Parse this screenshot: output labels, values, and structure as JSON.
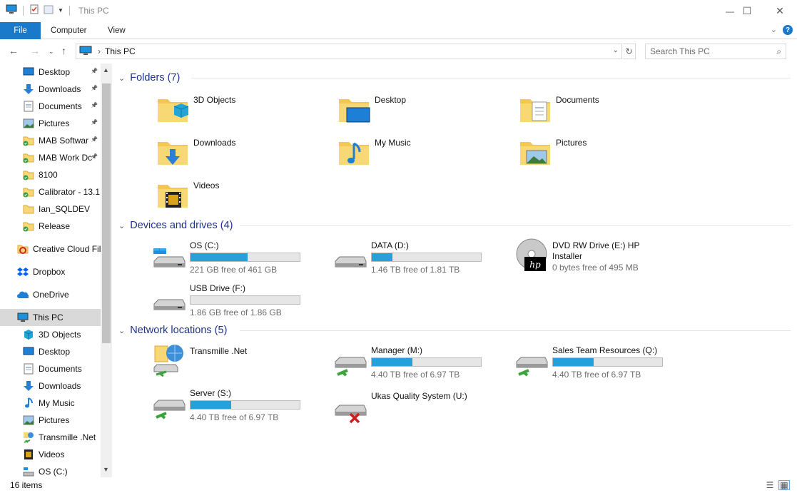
{
  "window": {
    "title": "This PC",
    "controls": {
      "minimize": "—",
      "maximize": "☐",
      "close": "✕"
    }
  },
  "ribbon": {
    "tabs": [
      "File",
      "Computer",
      "View"
    ],
    "help": "?"
  },
  "address": {
    "path": "This PC",
    "search_placeholder": "Search This PC"
  },
  "navpane": {
    "items": [
      {
        "label": "Desktop",
        "icon": "desktop-icon",
        "pinned": true
      },
      {
        "label": "Downloads",
        "icon": "downloads-icon",
        "pinned": true
      },
      {
        "label": "Documents",
        "icon": "documents-icon",
        "pinned": true
      },
      {
        "label": "Pictures",
        "icon": "pictures-icon",
        "pinned": true
      },
      {
        "label": "MAB Softwar",
        "icon": "folder-synced-icon",
        "pinned": true
      },
      {
        "label": "MAB Work Dc",
        "icon": "folder-synced-icon",
        "pinned": true
      },
      {
        "label": "8100",
        "icon": "folder-synced-icon",
        "pinned": false
      },
      {
        "label": "Calibrator - 13.1.",
        "icon": "folder-synced-icon",
        "pinned": false
      },
      {
        "label": "Ian_SQLDEV",
        "icon": "folder-icon",
        "pinned": false
      },
      {
        "label": "Release",
        "icon": "folder-synced-icon",
        "pinned": false
      },
      {
        "label": "Creative Cloud Fil",
        "icon": "creative-cloud-icon",
        "pinned": false
      },
      {
        "label": "Dropbox",
        "icon": "dropbox-icon",
        "pinned": false
      },
      {
        "label": "OneDrive",
        "icon": "onedrive-icon",
        "pinned": false
      },
      {
        "label": "This PC",
        "icon": "computer-icon",
        "pinned": false,
        "selected": true
      },
      {
        "label": "3D Objects",
        "icon": "3d-objects-icon",
        "pinned": false
      },
      {
        "label": "Desktop",
        "icon": "desktop-icon",
        "pinned": false
      },
      {
        "label": "Documents",
        "icon": "documents-icon",
        "pinned": false
      },
      {
        "label": "Downloads",
        "icon": "downloads-icon",
        "pinned": false
      },
      {
        "label": "My Music",
        "icon": "music-icon",
        "pinned": false
      },
      {
        "label": "Pictures",
        "icon": "pictures-icon",
        "pinned": false
      },
      {
        "label": "Transmille .Net",
        "icon": "network-location-icon",
        "pinned": false
      },
      {
        "label": "Videos",
        "icon": "videos-icon",
        "pinned": false
      },
      {
        "label": "OS (C:)",
        "icon": "os-drive-icon",
        "pinned": false
      }
    ]
  },
  "groups": {
    "folders": {
      "title": "Folders (7)",
      "items": [
        "3D Objects",
        "Desktop",
        "Documents",
        "Downloads",
        "My Music",
        "Pictures",
        "Videos"
      ]
    },
    "devices": {
      "title": "Devices and drives (4)",
      "items": [
        {
          "name": "OS (C:)",
          "free": "221 GB free of 461 GB",
          "used_fraction": 0.52
        },
        {
          "name": "DATA (D:)",
          "free": "1.46 TB free of 1.81 TB",
          "used_fraction": 0.19
        },
        {
          "name": "DVD RW Drive (E:) HP Installer",
          "free": "0 bytes free of 495 MB",
          "used_fraction": 1.0
        },
        {
          "name": "USB Drive (F:)",
          "free": "1.86 GB free of 1.86 GB",
          "used_fraction": 0.0
        }
      ]
    },
    "network": {
      "title": "Network locations (5)",
      "items": [
        {
          "name": "Transmille .Net"
        },
        {
          "name": "Manager (M:)",
          "free": "4.40 TB free of 6.97 TB",
          "used_fraction": 0.37
        },
        {
          "name": "Sales Team Resources (Q:)",
          "free": "4.40 TB free of 6.97 TB",
          "used_fraction": 0.37
        },
        {
          "name": "Server (S:)",
          "free": "4.40 TB free of 6.97 TB",
          "used_fraction": 0.37
        },
        {
          "name": "Ukas Quality System (U:)"
        }
      ]
    }
  },
  "status": {
    "count": "16 items"
  },
  "colors": {
    "accent": "#1979ca",
    "bar": "#26a0da",
    "group_header": "#1e3287",
    "folder": "#f8d775"
  }
}
